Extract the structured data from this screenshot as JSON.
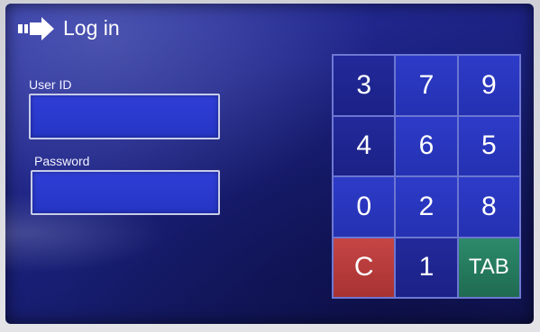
{
  "header": {
    "title": "Log in",
    "icon": "arrow-right-icon"
  },
  "form": {
    "user_id_label": "User ID",
    "user_id_value": "",
    "password_label": "Password",
    "password_value": ""
  },
  "keypad": {
    "keys": [
      {
        "label": "3",
        "style": "dark"
      },
      {
        "label": "7",
        "style": "normal"
      },
      {
        "label": "9",
        "style": "normal"
      },
      {
        "label": "4",
        "style": "dark"
      },
      {
        "label": "6",
        "style": "normal"
      },
      {
        "label": "5",
        "style": "normal"
      },
      {
        "label": "0",
        "style": "normal"
      },
      {
        "label": "2",
        "style": "normal"
      },
      {
        "label": "8",
        "style": "normal"
      },
      {
        "label": "C",
        "style": "clear"
      },
      {
        "label": "1",
        "style": "dark"
      },
      {
        "label": "TAB",
        "style": "tab"
      }
    ]
  },
  "colors": {
    "screen_bg": "#1c2282",
    "clear_key": "#b53a3a",
    "tab_key": "#267a5e"
  }
}
